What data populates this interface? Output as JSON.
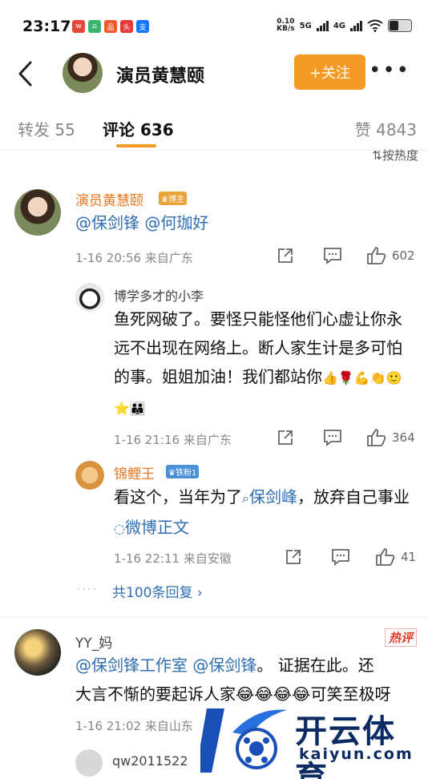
{
  "status_bar": {
    "time": "23:17",
    "speed_value": "0.10",
    "speed_unit": "KB/s",
    "net1": "5G",
    "net2": "4G"
  },
  "header": {
    "title": "演员黄慧颐",
    "follow_label": "+关注",
    "more_label": "•••"
  },
  "tabs": [
    {
      "label": "转发 55"
    },
    {
      "label": "评论 636"
    },
    {
      "label": "赞 4843"
    }
  ],
  "sort_label": "按热度",
  "comments": [
    {
      "name": "演员黄慧颐",
      "badge": "博主",
      "text_parts": [
        "@保剑锋",
        " ",
        "@何珈好"
      ],
      "time": "1-16 20:56",
      "location": "来自广东",
      "likes": "602",
      "replies": [
        {
          "name": "博学多才的小李",
          "text": "鱼死网破了。要怪只能怪他们心虚让你永远不出现在网络上。断人家生计是多可怕的事。姐姐加油！我们都站你",
          "emoji": "👍🌹💪👏🙂⭐👪",
          "time": "1-16 21:16",
          "location": "来自广东",
          "likes": "364"
        },
        {
          "name": "锦鲤王",
          "badge": "铁粉1",
          "text_before": "看这个，当年为了",
          "search_link": "保剑峰",
          "text_middle": "，放弃自己事业",
          "topic_link": "微博正文",
          "time": "1-16 22:11",
          "location": "来自安徽",
          "likes": "41"
        }
      ],
      "more_replies": "共100条回复"
    },
    {
      "name": "YY_妈",
      "hot_tag": "热评",
      "mention1": "@保剑锋工作室",
      "mention2": "@保剑锋",
      "line1_rest": "。 证据在此。还",
      "line2": "大言不惭的要起诉人家😂😂😂😂可笑至极呀",
      "time": "1-16 21:02",
      "location": "来自山东"
    },
    {
      "name": "qw2011522"
    }
  ],
  "watermark": {
    "text": "开云体育",
    "url": "kaiyun.com"
  },
  "colors": {
    "accent_orange": "#f59a24",
    "link_blue": "#2f6eb1",
    "name_orange": "#e8761c"
  }
}
